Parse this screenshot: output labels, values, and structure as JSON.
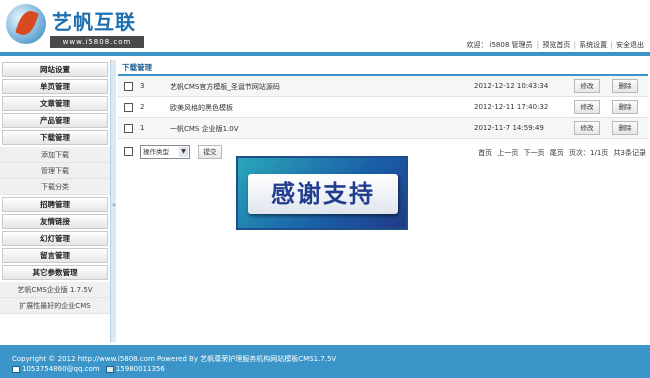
{
  "header": {
    "logo_text": "艺帆互联",
    "logo_url": "www.i5808.com",
    "welcome": "欢迎：",
    "user": "i5808 管理员",
    "nav": [
      "预览首页",
      "系统设置",
      "安全退出"
    ]
  },
  "sidebar": {
    "menus": [
      {
        "label": "网站设置"
      },
      {
        "label": "单页管理"
      },
      {
        "label": "文章管理"
      },
      {
        "label": "产品管理"
      },
      {
        "label": "下载管理",
        "subs": [
          "添加下载",
          "管理下载",
          "下载分类"
        ]
      },
      {
        "label": "招聘管理"
      },
      {
        "label": "友情链接"
      },
      {
        "label": "幻灯管理"
      },
      {
        "label": "留言管理"
      },
      {
        "label": "其它参数管理",
        "subs": [
          "艺帆CMS企业版 1.7.5V",
          "扩展性最好的企业CMS"
        ]
      }
    ]
  },
  "main": {
    "title": "下载管理",
    "rows": [
      {
        "num": "3",
        "title": "艺帆CMS官方模板_圣诞节网站源码",
        "date": "2012-12-12 10:43:34"
      },
      {
        "num": "2",
        "title": "欧美风格的黑色模板",
        "date": "2012-12-11 17:40:32"
      },
      {
        "num": "1",
        "title": "一帆CMS 企业版1.0V",
        "date": "2012-11-7 14:59:49"
      }
    ],
    "edit_label": "修改",
    "delete_label": "删除",
    "action_select": "操作类型",
    "submit_label": "提交",
    "pager": {
      "first": "首页",
      "prev": "上一页",
      "next": "下一页",
      "last": "尾页",
      "page_info": "页次：1/1页",
      "total": "共3条记录"
    }
  },
  "banner": {
    "text": "感谢支持"
  },
  "footer": {
    "copyright": "Copyright © 2012 http://www.i5808.com Powered By 艺帆尊荣护理服务机构网站模板CMS1.7.5V",
    "email": "1053754860@qq.com",
    "phone": "15980011356"
  },
  "colors": {
    "accent": "#3b95c9",
    "logo_blue": "#1c6fb0",
    "logo_orange": "#d94a22"
  }
}
